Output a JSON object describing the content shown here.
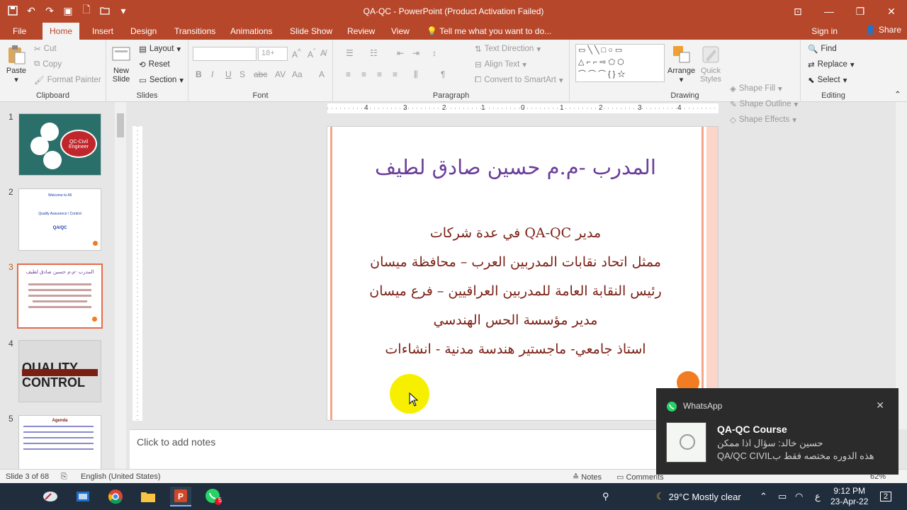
{
  "window": {
    "title": "QA-QC - PowerPoint (Product Activation Failed)"
  },
  "tabs": [
    {
      "label": "File"
    },
    {
      "label": "Home"
    },
    {
      "label": "Insert"
    },
    {
      "label": "Design"
    },
    {
      "label": "Transitions"
    },
    {
      "label": "Animations"
    },
    {
      "label": "Slide Show"
    },
    {
      "label": "Review"
    },
    {
      "label": "View"
    }
  ],
  "tell_me": "Tell me what you want to do...",
  "account": {
    "signin": "Sign in",
    "share": "Share"
  },
  "ribbon": {
    "clipboard": {
      "paste": "Paste",
      "cut": "Cut",
      "copy": "Copy",
      "format_painter": "Format Painter",
      "label": "Clipboard"
    },
    "slides": {
      "new_slide": "New",
      "new_slide2": "Slide",
      "layout": "Layout",
      "reset": "Reset",
      "section": "Section",
      "label": "Slides"
    },
    "font": {
      "size": "18+",
      "label": "Font"
    },
    "paragraph": {
      "text_direction": "Text Direction",
      "align_text": "Align Text",
      "convert_smartart": "Convert to SmartArt",
      "label": "Paragraph"
    },
    "drawing": {
      "arrange": "Arrange",
      "quick_styles": "Quick",
      "quick_styles2": "Styles",
      "shape_fill": "Shape Fill",
      "shape_outline": "Shape Outline",
      "shape_effects": "Shape Effects",
      "label": "Drawing"
    },
    "editing": {
      "find": "Find",
      "replace": "Replace",
      "select": "Select",
      "label": "Editing"
    }
  },
  "slides_panel": {
    "numbers": [
      "1",
      "2",
      "3",
      "4",
      "5"
    ],
    "thumb1_text": "QC-Civil Engineer",
    "thumb2_lines": [
      "Welcome to All",
      "Quality Assurance / Control",
      "QA/QC"
    ],
    "thumb4_text": "QUALITY CONTROL",
    "thumb5_title": "Agenda"
  },
  "ruler": {
    "labels": [
      "4",
      "3",
      "2",
      "1",
      "0",
      "1",
      "2",
      "3",
      "4"
    ]
  },
  "slide": {
    "title": "المدرب -م.م حسين صادق لطيف",
    "lines": [
      "مدير QA-QC في عدة شركات",
      "ممثل اتحاد نقابات المدربين العرب – محافظة ميسان",
      "رئيس النقابة العامة للمدربين العراقيين – فرع ميسان",
      "مدير مؤسسة الحس الهندسي",
      "استاذ جامعي- ماجستير هندسة مدنية - انشاءات"
    ]
  },
  "notes": {
    "placeholder": "Click to add notes"
  },
  "status": {
    "slide_info": "Slide 3 of 68",
    "language": "English (United States)",
    "notes": "Notes",
    "comments": "Comments",
    "zoom": "62%"
  },
  "toast": {
    "app": "WhatsApp",
    "title": "QA-QC Course",
    "line1": "حسين خالد: سؤال اذا ممكن",
    "line2": "هذه الدوره مختصه فقط بQA/QC CIVIL"
  },
  "taskbar": {
    "whatsapp_badge": "5",
    "weather": "29°C  Mostly clear",
    "lang": "ع",
    "time": "9:12 PM",
    "date": "23-Apr-22",
    "notif_count": "2"
  },
  "colors": {
    "accent": "#b7472a",
    "slide_title": "#6a3d9a",
    "slide_body": "#7a1f14"
  }
}
